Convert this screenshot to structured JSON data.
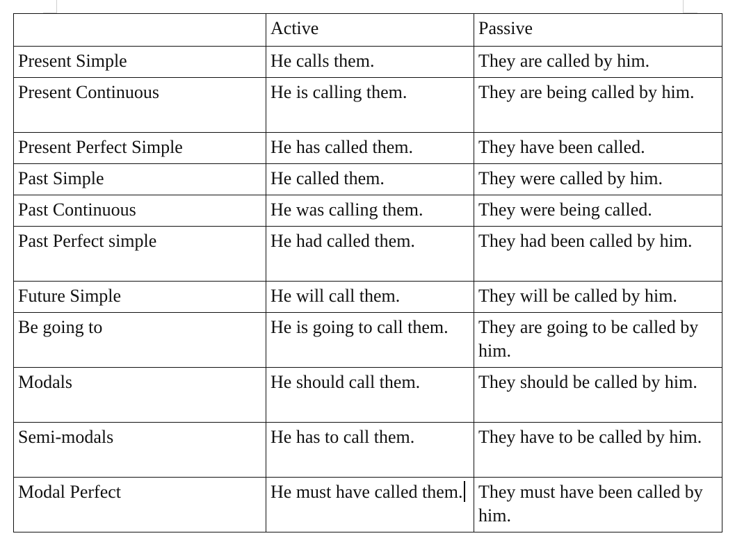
{
  "table": {
    "headers": [
      "",
      "Active",
      "Passive"
    ],
    "rows": [
      {
        "tense": "Present Simple",
        "active": "He calls them.",
        "passive": "They are called by him."
      },
      {
        "tense": "Present Continuous",
        "active": "He is calling them.",
        "passive": "They are being called by him."
      },
      {
        "tense": "Present Perfect Simple",
        "active": "He has called them.",
        "passive": "They have been called."
      },
      {
        "tense": "Past Simple",
        "active": "He called them.",
        "passive": "They were called by him."
      },
      {
        "tense": "Past Continuous",
        "active": "He was calling them.",
        "passive": "They were being called."
      },
      {
        "tense": "Past Perfect simple",
        "active": "He had called them.",
        "passive": "They had been called by him."
      },
      {
        "tense": "Future Simple",
        "active": "He will call them.",
        "passive": "They will be called by him."
      },
      {
        "tense": "Be going to",
        "active": "He is going to call them.",
        "passive": "They are going to be called by him."
      },
      {
        "tense": "Modals",
        "active": "He should call them.",
        "passive": "They should be called by him."
      },
      {
        "tense": "Semi-modals",
        "active": "He has to call them.",
        "passive": "They have to be called by him."
      },
      {
        "tense": "Modal Perfect",
        "active": "He must have called them.",
        "passive": "They must have been called by him."
      }
    ]
  }
}
